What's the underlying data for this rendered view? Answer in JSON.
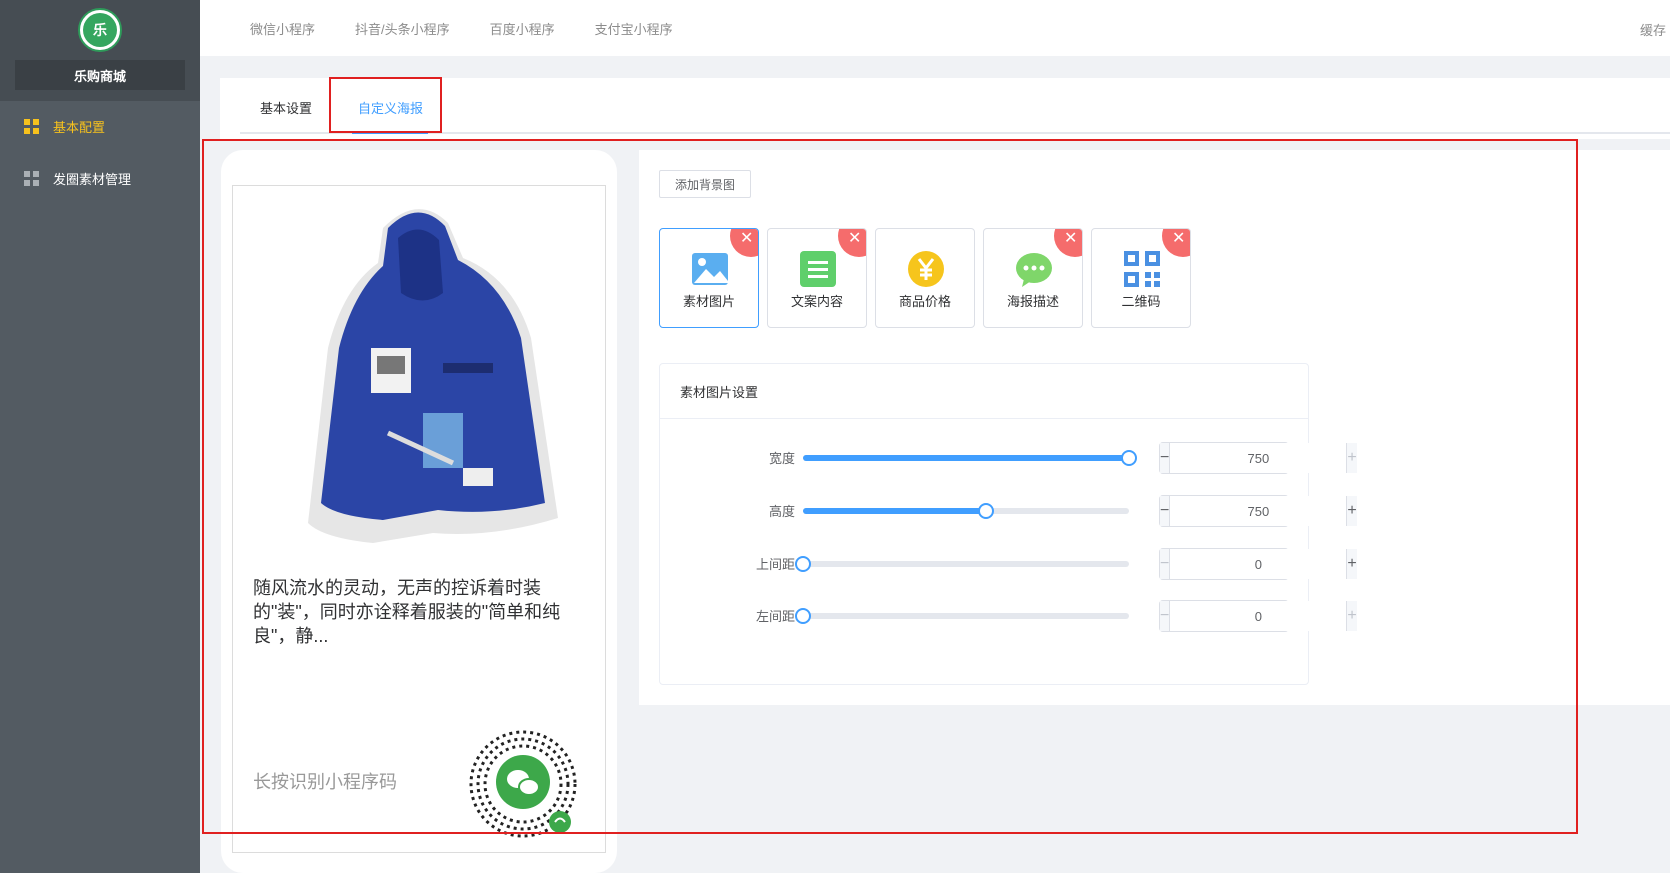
{
  "sidebar": {
    "logo_text": "乐",
    "shop_name": "乐购商城",
    "items": [
      {
        "label": "基本配置",
        "active": true
      },
      {
        "label": "发圈素材管理",
        "active": false
      }
    ]
  },
  "topnav": {
    "items": [
      "微信小程序",
      "抖音/头条小程序",
      "百度小程序",
      "支付宝小程序"
    ],
    "cache_label": "缓存"
  },
  "tabs": {
    "basic": "基本设置",
    "poster": "自定义海报"
  },
  "poster": {
    "description": "随风流水的灵动，无声的控诉着时装的\"装\"，同时亦诠释着服装的\"简单和纯良\"，静...",
    "hint": "长按识别小程序码"
  },
  "settings": {
    "add_bg_button": "添加背景图",
    "widgets": [
      {
        "label": "素材图片",
        "icon": "image-icon"
      },
      {
        "label": "文案内容",
        "icon": "text-icon"
      },
      {
        "label": "商品价格",
        "icon": "yen-icon"
      },
      {
        "label": "海报描述",
        "icon": "chat-icon"
      },
      {
        "label": "二维码",
        "icon": "qrcode-icon"
      }
    ],
    "card_title": "素材图片设置",
    "rows": [
      {
        "label": "宽度",
        "value": "750",
        "fraction": 1.0
      },
      {
        "label": "高度",
        "value": "750",
        "fraction": 0.56
      },
      {
        "label": "上间距",
        "value": "0",
        "fraction": 0.0
      },
      {
        "label": "左间距",
        "value": "0",
        "fraction": 0.0
      }
    ]
  },
  "colors": {
    "sidebar_bg": "#535b62",
    "accent": "#409eff",
    "active_menu": "#f7c21d",
    "danger": "#f56c6c",
    "highlight_box": "#e02020"
  }
}
